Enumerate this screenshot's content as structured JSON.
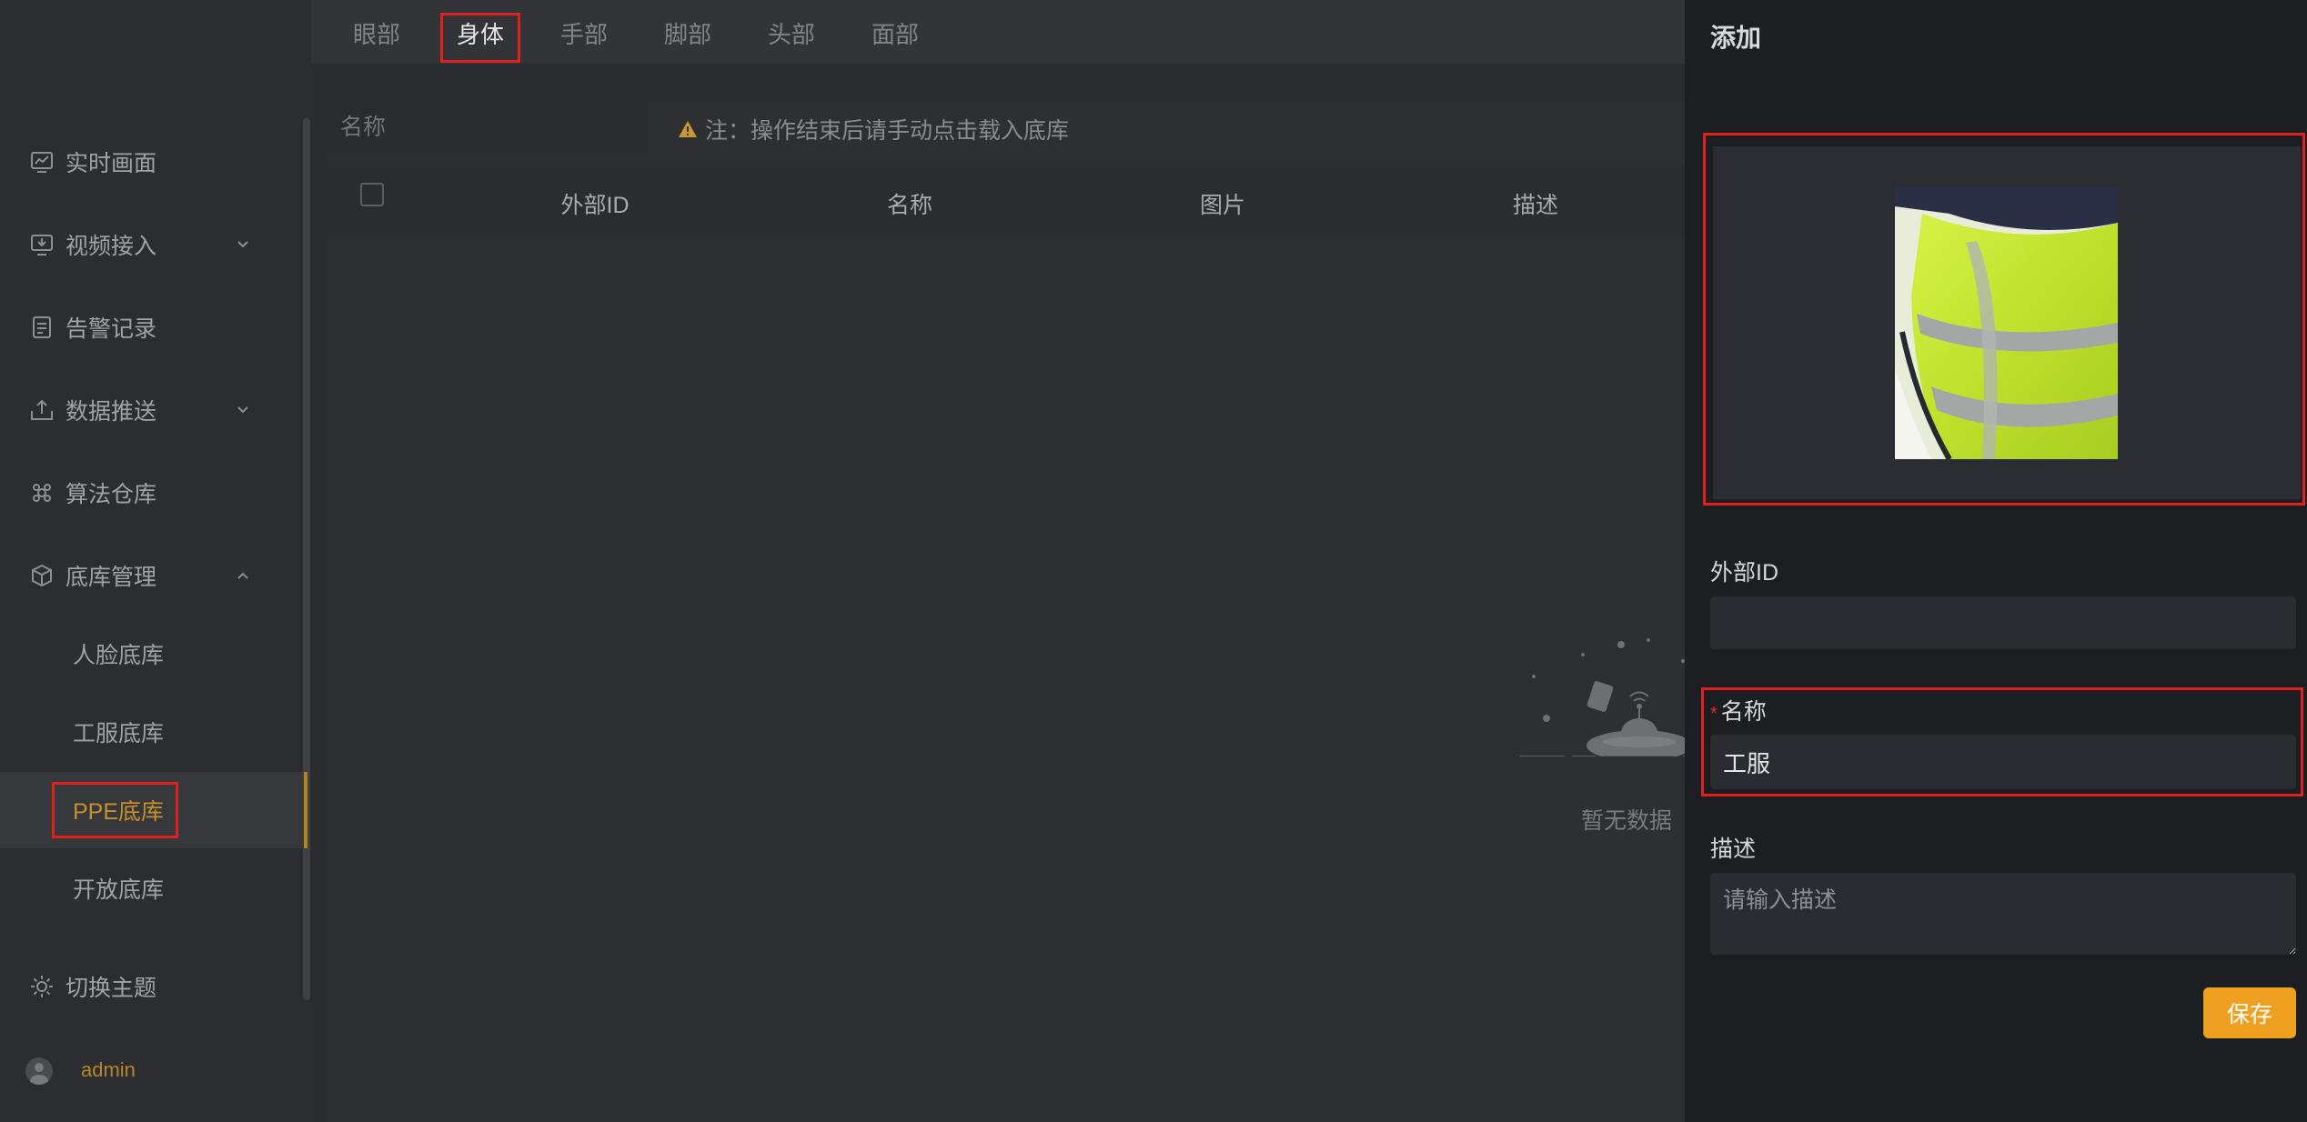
{
  "sidebar": {
    "items": [
      {
        "label": "实时画面",
        "icon": "monitor-chart-icon"
      },
      {
        "label": "视频接入",
        "icon": "video-input-icon"
      },
      {
        "label": "告警记录",
        "icon": "alarm-list-icon"
      },
      {
        "label": "数据推送",
        "icon": "upload-icon"
      },
      {
        "label": "算法仓库",
        "icon": "algorithm-icon"
      },
      {
        "label": "底库管理",
        "icon": "cube-icon"
      }
    ],
    "sub_items": [
      {
        "label": "人脸底库"
      },
      {
        "label": "工服底库"
      },
      {
        "label": "PPE底库"
      },
      {
        "label": "开放底库"
      }
    ],
    "theme_label": "切换主题",
    "user": "admin"
  },
  "tabs": [
    "眼部",
    "身体",
    "手部",
    "脚部",
    "头部",
    "面部"
  ],
  "active_tab": "身体",
  "search": {
    "placeholder": "名称"
  },
  "notice": "注：操作结束后请手动点击载入底库",
  "table": {
    "columns": [
      "外部ID",
      "名称",
      "图片",
      "描述"
    ],
    "empty_text": "暂无数据"
  },
  "drawer": {
    "title": "添加",
    "external_id_label": "外部ID",
    "external_id_value": "",
    "name_label": "名称",
    "name_value": "工服",
    "desc_label": "描述",
    "desc_placeholder": "请输入描述",
    "save_label": "保存"
  },
  "colors": {
    "accent": "#f0a020",
    "active_text": "#c6902c",
    "highlight": "#e0201c"
  }
}
